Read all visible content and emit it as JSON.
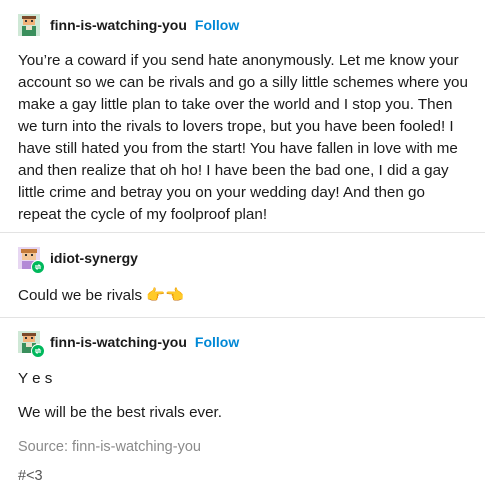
{
  "post1": {
    "username": "finn-is-watching-you",
    "follow_label": "Follow",
    "body": "You’re a coward if you send hate anonymously. Let me know your account so we can be rivals and go a silly little schemes where you make a gay little plan to take over the world and I stop you. Then we turn into the rivals to lovers trope, but you have been fooled! I have still hated you from the start! You have fallen in love with me and then realize that oh ho! I have been the bad one, I did a gay little crime and betray you on your wedding day! And then go repeat the cycle of my foolproof plan!",
    "avatar_icon": "pixel-avatar-icon"
  },
  "post2": {
    "username": "idiot-synergy",
    "body": "Could we be rivals",
    "emoji": "👉👈",
    "avatar_icon": "pixel-avatar-icon",
    "badge_icon": "reblog-icon"
  },
  "post3": {
    "username": "finn-is-watching-you",
    "follow_label": "Follow",
    "line1": "Y e s",
    "line2": "We will be the best rivals ever.",
    "avatar_icon": "pixel-avatar-icon",
    "badge_icon": "reblog-icon"
  },
  "source_text": "Source: finn-is-watching-you",
  "tag": "#<3",
  "colors": {
    "follow": "#0088d6",
    "reblog_badge": "#00b85c",
    "divider": "#e3e3e3"
  }
}
